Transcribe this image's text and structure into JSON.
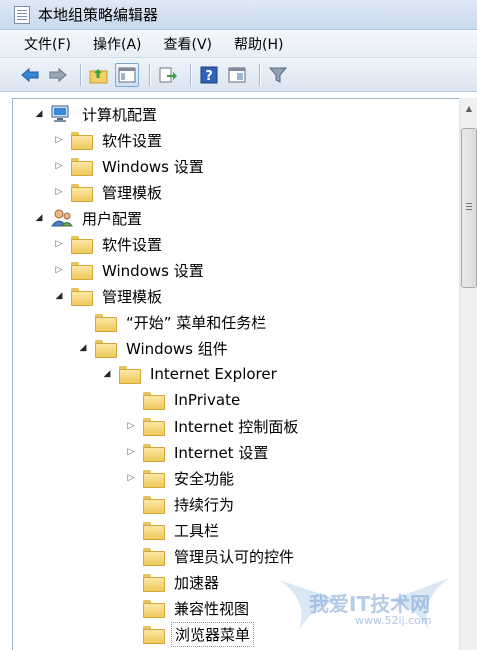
{
  "window": {
    "title": "本地组策略编辑器"
  },
  "menu": [
    "文件(F)",
    "操作(A)",
    "查看(V)",
    "帮助(H)"
  ],
  "tree": [
    {
      "label": "计算机配置",
      "level": 0,
      "toggle": "expanded",
      "icon": "computer-icon"
    },
    {
      "label": "软件设置",
      "level": 1,
      "toggle": "collapsed",
      "icon": "folder-icon"
    },
    {
      "label": "Windows 设置",
      "level": 1,
      "toggle": "collapsed",
      "icon": "folder-icon"
    },
    {
      "label": "管理模板",
      "level": 1,
      "toggle": "collapsed",
      "icon": "folder-icon"
    },
    {
      "label": "用户配置",
      "level": 0,
      "toggle": "expanded",
      "icon": "user-icon"
    },
    {
      "label": "软件设置",
      "level": 1,
      "toggle": "collapsed",
      "icon": "folder-icon"
    },
    {
      "label": "Windows 设置",
      "level": 1,
      "toggle": "collapsed",
      "icon": "folder-icon"
    },
    {
      "label": "管理模板",
      "level": 1,
      "toggle": "expanded",
      "icon": "folder-icon"
    },
    {
      "label": "“开始” 菜单和任务栏",
      "level": 2,
      "toggle": "none",
      "icon": "folder-icon"
    },
    {
      "label": "Windows 组件",
      "level": 2,
      "toggle": "expanded",
      "icon": "folder-icon"
    },
    {
      "label": "Internet Explorer",
      "level": 3,
      "toggle": "expanded",
      "icon": "folder-icon"
    },
    {
      "label": "InPrivate",
      "level": 4,
      "toggle": "none",
      "icon": "folder-icon"
    },
    {
      "label": "Internet 控制面板",
      "level": 4,
      "toggle": "collapsed",
      "icon": "folder-icon"
    },
    {
      "label": "Internet 设置",
      "level": 4,
      "toggle": "collapsed",
      "icon": "folder-icon"
    },
    {
      "label": "安全功能",
      "level": 4,
      "toggle": "collapsed",
      "icon": "folder-icon"
    },
    {
      "label": "持续行为",
      "level": 4,
      "toggle": "none",
      "icon": "folder-icon"
    },
    {
      "label": "工具栏",
      "level": 4,
      "toggle": "none",
      "icon": "folder-icon"
    },
    {
      "label": "管理员认可的控件",
      "level": 4,
      "toggle": "none",
      "icon": "folder-icon"
    },
    {
      "label": "加速器",
      "level": 4,
      "toggle": "none",
      "icon": "folder-icon"
    },
    {
      "label": "兼容性视图",
      "level": 4,
      "toggle": "none",
      "icon": "folder-icon"
    },
    {
      "label": "浏览器菜单",
      "level": 4,
      "toggle": "none",
      "icon": "folder-icon",
      "selected": true
    }
  ],
  "watermark": {
    "text": "我爱IT技术网",
    "url": "www.52ij.com"
  }
}
